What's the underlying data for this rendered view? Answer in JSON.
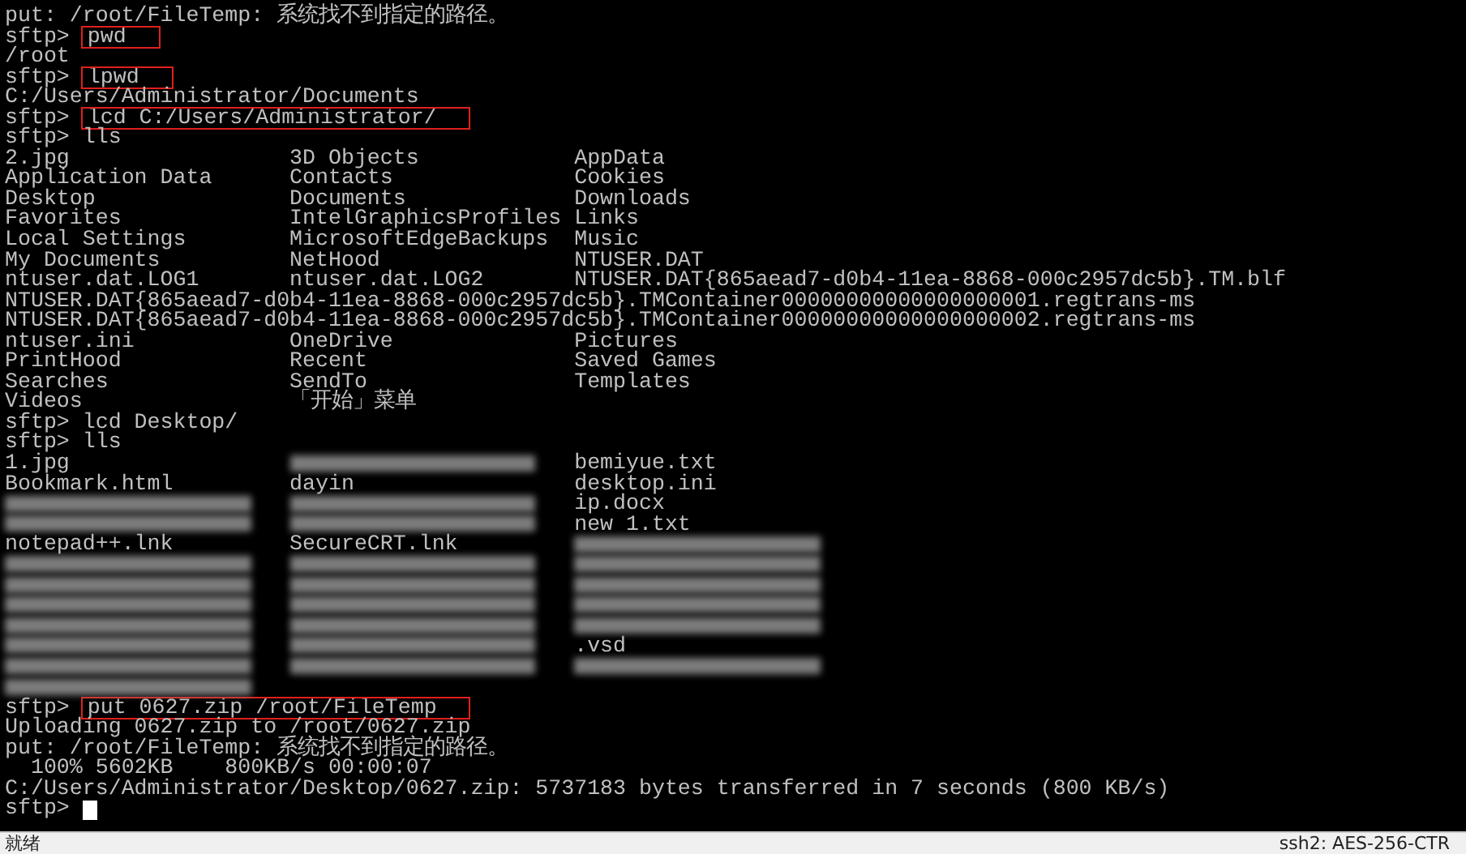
{
  "terminal": {
    "lines": [
      {
        "kind": "output",
        "text": "put: /root/FileTemp: 系统找不到指定的路径。"
      },
      {
        "kind": "command",
        "prompt": "sftp>",
        "command": "pwd",
        "boxed": true
      },
      {
        "kind": "output",
        "text": "/root"
      },
      {
        "kind": "command",
        "prompt": "sftp>",
        "command": "lpwd",
        "boxed": true
      },
      {
        "kind": "output",
        "text": "C:/Users/Administrator/Documents"
      },
      {
        "kind": "command",
        "prompt": "sftp>",
        "command": "lcd C:/Users/Administrator/",
        "boxed": true
      },
      {
        "kind": "command",
        "prompt": "sftp>",
        "command": "lls",
        "boxed": false
      },
      {
        "kind": "listing",
        "cells": [
          {
            "kind": "file",
            "text": "2.jpg"
          },
          {
            "kind": "file",
            "text": "3D Objects"
          },
          {
            "kind": "file",
            "text": "AppData"
          }
        ]
      },
      {
        "kind": "listing",
        "cells": [
          {
            "kind": "file",
            "text": "Application Data"
          },
          {
            "kind": "file",
            "text": "Contacts"
          },
          {
            "kind": "file",
            "text": "Cookies"
          }
        ]
      },
      {
        "kind": "listing",
        "cells": [
          {
            "kind": "file",
            "text": "Desktop"
          },
          {
            "kind": "file",
            "text": "Documents"
          },
          {
            "kind": "file",
            "text": "Downloads"
          }
        ]
      },
      {
        "kind": "listing",
        "cells": [
          {
            "kind": "file",
            "text": "Favorites"
          },
          {
            "kind": "file",
            "text": "IntelGraphicsProfiles"
          },
          {
            "kind": "file",
            "text": "Links"
          }
        ]
      },
      {
        "kind": "listing",
        "cells": [
          {
            "kind": "file",
            "text": "Local Settings"
          },
          {
            "kind": "file",
            "text": "MicrosoftEdgeBackups"
          },
          {
            "kind": "file",
            "text": "Music"
          }
        ]
      },
      {
        "kind": "listing",
        "cells": [
          {
            "kind": "file",
            "text": "My Documents"
          },
          {
            "kind": "file",
            "text": "NetHood"
          },
          {
            "kind": "file",
            "text": "NTUSER.DAT"
          }
        ]
      },
      {
        "kind": "listing",
        "cells": [
          {
            "kind": "file",
            "text": "ntuser.dat.LOG1"
          },
          {
            "kind": "file",
            "text": "ntuser.dat.LOG2"
          },
          {
            "kind": "file",
            "text": "NTUSER.DAT{865aead7-d0b4-11ea-8868-000c2957dc5b}.TM.blf"
          }
        ]
      },
      {
        "kind": "output",
        "text": "NTUSER.DAT{865aead7-d0b4-11ea-8868-000c2957dc5b}.TMContainer00000000000000000001.regtrans-ms"
      },
      {
        "kind": "output",
        "text": "NTUSER.DAT{865aead7-d0b4-11ea-8868-000c2957dc5b}.TMContainer00000000000000000002.regtrans-ms"
      },
      {
        "kind": "listing",
        "cells": [
          {
            "kind": "file",
            "text": "ntuser.ini"
          },
          {
            "kind": "file",
            "text": "OneDrive"
          },
          {
            "kind": "file",
            "text": "Pictures"
          }
        ]
      },
      {
        "kind": "listing",
        "cells": [
          {
            "kind": "file",
            "text": "PrintHood"
          },
          {
            "kind": "file",
            "text": "Recent"
          },
          {
            "kind": "file",
            "text": "Saved Games"
          }
        ]
      },
      {
        "kind": "listing",
        "cells": [
          {
            "kind": "file",
            "text": "Searches"
          },
          {
            "kind": "file",
            "text": "SendTo"
          },
          {
            "kind": "file",
            "text": "Templates"
          }
        ]
      },
      {
        "kind": "listing",
        "cells": [
          {
            "kind": "file",
            "text": "Videos"
          },
          {
            "kind": "file",
            "text": "「开始」菜单"
          }
        ]
      },
      {
        "kind": "command",
        "prompt": "sftp>",
        "command": "lcd Desktop/",
        "boxed": false
      },
      {
        "kind": "command",
        "prompt": "sftp>",
        "command": "lls",
        "boxed": false
      },
      {
        "kind": "listing",
        "cells": [
          {
            "kind": "file",
            "text": "1.jpg"
          },
          {
            "kind": "blur"
          },
          {
            "kind": "file",
            "text": "bemiyue.txt"
          }
        ]
      },
      {
        "kind": "listing",
        "cells": [
          {
            "kind": "file",
            "text": "Bookmark.html"
          },
          {
            "kind": "file",
            "text": "dayin"
          },
          {
            "kind": "file",
            "text": "desktop.ini"
          }
        ]
      },
      {
        "kind": "listing",
        "cells": [
          {
            "kind": "blur"
          },
          {
            "kind": "blur"
          },
          {
            "kind": "file",
            "text": "ip.docx"
          }
        ]
      },
      {
        "kind": "listing",
        "cells": [
          {
            "kind": "blur"
          },
          {
            "kind": "blur"
          },
          {
            "kind": "file",
            "text": "new 1.txt"
          }
        ]
      },
      {
        "kind": "listing",
        "cells": [
          {
            "kind": "file",
            "text": "notepad++.lnk"
          },
          {
            "kind": "file",
            "text": "SecureCRT.lnk"
          },
          {
            "kind": "blur"
          }
        ]
      },
      {
        "kind": "listing",
        "cells": [
          {
            "kind": "blur"
          },
          {
            "kind": "blur"
          },
          {
            "kind": "blur"
          }
        ]
      },
      {
        "kind": "listing",
        "cells": [
          {
            "kind": "blur"
          },
          {
            "kind": "blur"
          },
          {
            "kind": "blur"
          }
        ]
      },
      {
        "kind": "listing",
        "cells": [
          {
            "kind": "blur"
          },
          {
            "kind": "blur"
          },
          {
            "kind": "blur"
          }
        ]
      },
      {
        "kind": "listing",
        "cells": [
          {
            "kind": "blur"
          },
          {
            "kind": "blur"
          },
          {
            "kind": "blur"
          }
        ]
      },
      {
        "kind": "listing",
        "cells": [
          {
            "kind": "blur"
          },
          {
            "kind": "blur"
          },
          {
            "kind": "file",
            "text": ".vsd"
          }
        ]
      },
      {
        "kind": "listing",
        "cells": [
          {
            "kind": "blur"
          },
          {
            "kind": "blur"
          },
          {
            "kind": "blur"
          }
        ]
      },
      {
        "kind": "listing",
        "cells": [
          {
            "kind": "blur"
          }
        ]
      },
      {
        "kind": "command",
        "prompt": "sftp>",
        "command": "put 0627.zip /root/FileTemp",
        "boxed": true
      },
      {
        "kind": "output",
        "text": "Uploading 0627.zip to /root/0627.zip"
      },
      {
        "kind": "output",
        "text": "put: /root/FileTemp: 系统找不到指定的路径。"
      },
      {
        "kind": "output",
        "text": "  100% 5602KB    800KB/s 00:00:07"
      },
      {
        "kind": "output",
        "text": "C:/Users/Administrator/Desktop/0627.zip: 5737183 bytes transferred in 7 seconds (800 KB/s)"
      },
      {
        "kind": "input",
        "prompt": "sftp>"
      }
    ]
  },
  "status_bar": {
    "left": "就绪",
    "right": "ssh2: AES-256-CTR"
  }
}
